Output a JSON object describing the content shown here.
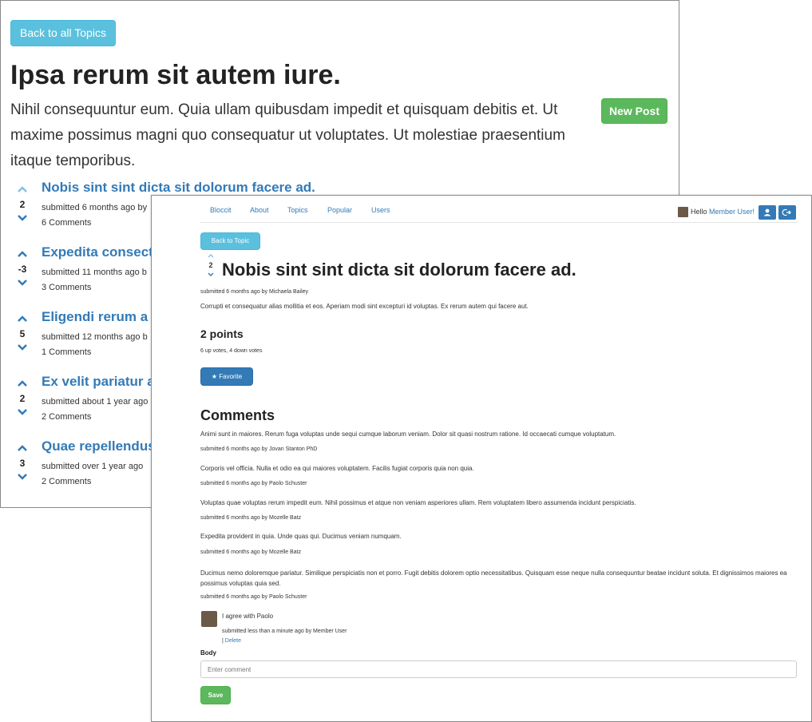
{
  "topic_page": {
    "back_button": "Back to all Topics",
    "title": "Ipsa rerum sit autem iure.",
    "description": "Nihil consequuntur eum. Quia ullam quibusdam impedit et quisquam debitis et. Ut maxime possimus magni quo consequatur ut voluptates. Ut molestiae praesentium itaque temporibus.",
    "new_post_button": "New Post",
    "posts": [
      {
        "score": "2",
        "title": "Nobis sint sint dicta sit dolorum facere ad.",
        "submitted": "submitted 6 months ago by",
        "comments": "6 Comments"
      },
      {
        "score": "-3",
        "title": "Expedita consect",
        "submitted": "submitted 11 months ago b",
        "comments": "3 Comments"
      },
      {
        "score": "5",
        "title": "Eligendi rerum a p",
        "submitted": "submitted 12 months ago b",
        "comments": "1 Comments"
      },
      {
        "score": "2",
        "title": "Ex velit pariatur a",
        "submitted": "submitted about 1 year ago",
        "comments": "2 Comments"
      },
      {
        "score": "3",
        "title": "Quae repellendus",
        "submitted": "submitted over 1 year ago",
        "comments": "2 Comments"
      }
    ]
  },
  "post_page": {
    "nav": {
      "items": [
        "Bloccit",
        "About",
        "Topics",
        "Popular",
        "Users"
      ],
      "hello": "Hello",
      "user_link": "Member User!",
      "user_icon": "user-icon",
      "signout_icon": "sign-out-icon"
    },
    "back_button": "Back to Topic",
    "score": "2",
    "title": "Nobis sint sint dicta sit dolorum facere ad.",
    "submitted": "submitted 6 months ago by Michaela Bailey",
    "body": "Corrupti et consequatur alias mollitia et eos. Aperiam modi sint excepturi id voluptas. Ex rerum autem qui facere aut.",
    "points": "2 points",
    "votes": "6 up votes, 4 down votes",
    "favorite_button": "Favorite",
    "comments_heading": "Comments",
    "comments": [
      {
        "text": "Animi sunt in maiores. Rerum fuga voluptas unde sequi cumque laborum veniam. Dolor sit quasi nostrum ratione. Id occaecati cumque voluptatum.",
        "meta": "submitted 6 months ago by Jovan Stanton PhD"
      },
      {
        "text": "Corporis vel officia. Nulla et odio ea qui maiores voluptatem. Facilis fugiat corporis quia non quia.",
        "meta": "submitted 6 months ago by Paolo Schuster"
      },
      {
        "text": "Voluptas quae voluptas rerum impedit eum. Nihil possimus et atque non veniam asperiores ullam. Rem voluptatem libero assumenda incidunt perspiciatis.",
        "meta": "submitted 6 months ago by Mozelle Batz"
      },
      {
        "text": "Expedita provident in quia. Unde quas qui. Ducimus veniam numquam.",
        "meta": "submitted 6 months ago by Mozelle Batz"
      },
      {
        "text": "Ducimus nemo doloremque pariatur. Similique perspiciatis non et porro. Fugit debitis dolorem optio necessitatibus. Quisquam esse neque nulla consequuntur beatae incidunt soluta. Et dignissimos maiores ea possimus voluptas quia sed.",
        "meta": "submitted 6 months ago by Paolo Schuster"
      }
    ],
    "own_comment": {
      "text": "I agree with Paolo",
      "meta": "submitted less than a minute ago by Member User",
      "separator": "|",
      "delete_link": "Delete"
    },
    "form": {
      "label": "Body",
      "placeholder": "Enter comment",
      "save_button": "Save"
    }
  },
  "colors": {
    "link": "#337ab7",
    "info": "#5bc0de",
    "success": "#5cb85c",
    "primary": "#337ab7"
  }
}
